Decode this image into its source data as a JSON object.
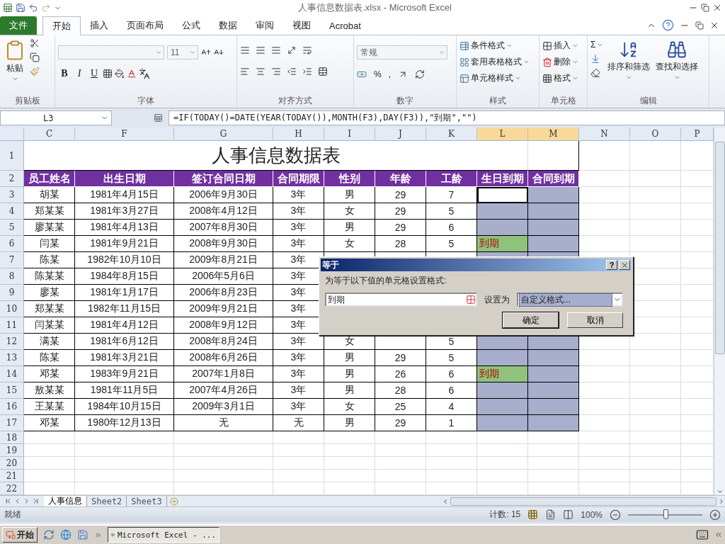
{
  "window": {
    "title": "人事信息数据表.xlsx - Microsoft Excel"
  },
  "ribbon_tabs": [
    {
      "label": "文件",
      "kind": "file",
      "selected": false
    },
    {
      "label": "开始",
      "kind": "tab",
      "selected": true
    },
    {
      "label": "插入",
      "kind": "tab",
      "selected": false
    },
    {
      "label": "页面布局",
      "kind": "tab",
      "selected": false
    },
    {
      "label": "公式",
      "kind": "tab",
      "selected": false
    },
    {
      "label": "数据",
      "kind": "tab",
      "selected": false
    },
    {
      "label": "审阅",
      "kind": "tab",
      "selected": false
    },
    {
      "label": "视图",
      "kind": "tab",
      "selected": false
    },
    {
      "label": "Acrobat",
      "kind": "tab",
      "selected": false
    }
  ],
  "ribbon": {
    "clipboard": {
      "label": "剪贴板",
      "paste": "粘贴"
    },
    "font": {
      "label": "字体",
      "size": "11",
      "styles": [
        "B",
        "I",
        "U"
      ]
    },
    "alignment": {
      "label": "对齐方式"
    },
    "number": {
      "label": "数字",
      "format": "常规",
      "percent": "%",
      "comma": ","
    },
    "styles": {
      "label": "样式",
      "items": [
        "条件格式",
        "套用表格格式",
        "单元格样式"
      ]
    },
    "cells": {
      "label": "单元格",
      "items": [
        "插入",
        "删除",
        "格式"
      ]
    },
    "editing": {
      "label": "编辑",
      "sum": "Σ",
      "sort": "排序和筛选",
      "find": "查找和选择"
    }
  },
  "formula_bar": {
    "name_box": "L3",
    "formula": "=IF(TODAY()=DATE(YEAR(TODAY()),MONTH(F3),DAY(F3)),\"到期\",\"\")"
  },
  "sheet": {
    "columns": [
      {
        "label": "C",
        "selected": false
      },
      {
        "label": "F",
        "selected": false
      },
      {
        "label": "G",
        "selected": false
      },
      {
        "label": "H",
        "selected": false
      },
      {
        "label": "I",
        "selected": false
      },
      {
        "label": "J",
        "selected": false
      },
      {
        "label": "K",
        "selected": false
      },
      {
        "label": "L",
        "selected": true
      },
      {
        "label": "M",
        "selected": true
      },
      {
        "label": "N",
        "selected": false
      },
      {
        "label": "O",
        "selected": false
      },
      {
        "label": "P",
        "selected": false
      }
    ],
    "title_row": {
      "row": "1",
      "title": "人事信息数据表"
    },
    "header_row": {
      "row": "2",
      "cells": [
        "员工姓名",
        "出生日期",
        "签订合同日期",
        "合同期限",
        "性别",
        "年龄",
        "工龄",
        "生日到期",
        "合同到期"
      ]
    },
    "rows": [
      {
        "row": "3",
        "cells": [
          "胡某",
          "1981年4月15日",
          "2006年9月30日",
          "3年",
          "男",
          "29",
          "7"
        ],
        "l": {
          "kind": "active"
        },
        "m": {
          "kind": "selected"
        }
      },
      {
        "row": "4",
        "cells": [
          "郑某某",
          "1981年3月27日",
          "2008年4月12日",
          "3年",
          "女",
          "29",
          "5"
        ],
        "l": {
          "kind": "selected"
        },
        "m": {
          "kind": "selected"
        }
      },
      {
        "row": "5",
        "cells": [
          "廖某某",
          "1981年4月13日",
          "2007年8月30日",
          "3年",
          "男",
          "29",
          "6"
        ],
        "l": {
          "kind": "selected"
        },
        "m": {
          "kind": "selected"
        }
      },
      {
        "row": "6",
        "cells": [
          "闫某",
          "1981年9月21日",
          "2008年9月30日",
          "3年",
          "女",
          "28",
          "5"
        ],
        "l": {
          "kind": "due",
          "text": "到期"
        },
        "m": {
          "kind": "selected"
        }
      },
      {
        "row": "7",
        "cells": [
          "陈某",
          "1982年10月10日",
          "2009年8月21日",
          "3年"
        ],
        "l": {
          "kind": "selected"
        },
        "m": {
          "kind": "selected"
        }
      },
      {
        "row": "8",
        "cells": [
          "陈某某",
          "1984年8月15日",
          "2006年5月6日",
          "3年"
        ]
      },
      {
        "row": "9",
        "cells": [
          "廖某",
          "1981年1月17日",
          "2006年8月23日",
          "3年"
        ]
      },
      {
        "row": "10",
        "cells": [
          "郑某某",
          "1982年11月15日",
          "2009年9月21日",
          "3年"
        ]
      },
      {
        "row": "11",
        "cells": [
          "闫某某",
          "1981年4月12日",
          "2008年9月12日",
          "3年"
        ]
      },
      {
        "row": "12",
        "cells": [
          "满某",
          "1981年6月12日",
          "2008年8月24日",
          "3年",
          "女",
          null,
          "5"
        ],
        "l": {
          "kind": "selected"
        },
        "m": {
          "kind": "selected"
        }
      },
      {
        "row": "13",
        "cells": [
          "陈某",
          "1981年3月21日",
          "2008年6月26日",
          "3年",
          "男",
          "29",
          "5"
        ],
        "l": {
          "kind": "selected"
        },
        "m": {
          "kind": "selected"
        }
      },
      {
        "row": "14",
        "cells": [
          "邓某",
          "1983年9月21日",
          "2007年1月8日",
          "3年",
          "男",
          "26",
          "6"
        ],
        "l": {
          "kind": "due",
          "text": "到期"
        },
        "m": {
          "kind": "selected"
        }
      },
      {
        "row": "15",
        "cells": [
          "敖某某",
          "1981年11月5日",
          "2007年4月26日",
          "3年",
          "男",
          "28",
          "6"
        ],
        "l": {
          "kind": "selected"
        },
        "m": {
          "kind": "selected"
        }
      },
      {
        "row": "16",
        "cells": [
          "王某某",
          "1984年10月15日",
          "2009年3月1日",
          "3年",
          "女",
          "25",
          "4"
        ],
        "l": {
          "kind": "selected"
        },
        "m": {
          "kind": "selected"
        }
      },
      {
        "row": "17",
        "cells": [
          "邓某",
          "1980年12月13日",
          "无",
          "无",
          "男",
          "29",
          "1"
        ],
        "l": {
          "kind": "selected"
        },
        "m": {
          "kind": "selected"
        }
      }
    ],
    "empty_rows": [
      "18",
      "19",
      "20",
      "21",
      "22"
    ]
  },
  "sheet_tabs": [
    {
      "label": "人事信息",
      "selected": true
    },
    {
      "label": "Sheet2",
      "selected": false
    },
    {
      "label": "Sheet3",
      "selected": false
    }
  ],
  "status_bar": {
    "status": "就绪",
    "count": "计数: 15",
    "zoom": "100%",
    "zoom_level": {
      "level": 0.5
    }
  },
  "dialog": {
    "title": "等于",
    "help": "?",
    "prompt": "为等于以下值的单元格设置格式:",
    "value": "到期",
    "format_label": "设置为",
    "format": "自定义格式...",
    "buttons": [
      "确定",
      "取消"
    ]
  },
  "taskbar": {
    "start": "开始",
    "window": "Microsoft Excel - ..."
  }
}
